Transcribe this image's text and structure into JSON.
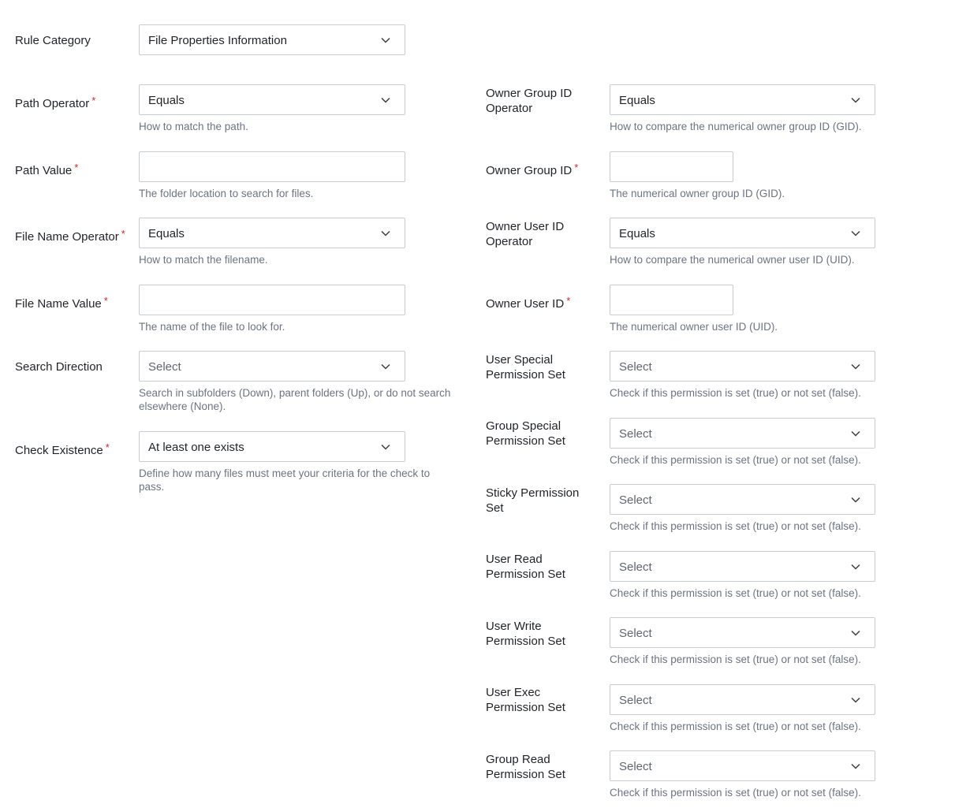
{
  "rule_category": {
    "label": "Rule Category",
    "value": "File Properties Information"
  },
  "left": {
    "path_operator": {
      "label": "Path Operator",
      "value": "Equals",
      "help": "How to match the path."
    },
    "path_value": {
      "label": "Path Value",
      "value": "",
      "help": "The folder location to search for files."
    },
    "file_name_operator": {
      "label": "File Name Operator",
      "value": "Equals",
      "help": "How to match the filename."
    },
    "file_name_value": {
      "label": "File Name Value",
      "value": "",
      "help": "The name of the file to look for."
    },
    "search_direction": {
      "label": "Search Direction",
      "value": "Select",
      "help_line1": "Search in subfolders (Down), parent folders (Up), or do not search",
      "help_line2": "elsewhere (None)."
    },
    "check_existence": {
      "label": "Check Existence",
      "value": "At least one exists",
      "help_line1": "Define how many files must meet your criteria for the check to",
      "help_line2": "pass."
    }
  },
  "right": {
    "owner_group_id_operator": {
      "label_line1": "Owner Group ID",
      "label_line2": "Operator",
      "value": "Equals",
      "help": "How to compare the numerical owner group ID (GID)."
    },
    "owner_group_id": {
      "label": "Owner Group ID",
      "value": "",
      "help": "The numerical owner group ID (GID)."
    },
    "owner_user_id_operator": {
      "label_line1": "Owner User ID",
      "label_line2": "Operator",
      "value": "Equals",
      "help": "How to compare the numerical owner user ID (UID)."
    },
    "owner_user_id": {
      "label": "Owner User ID",
      "value": "",
      "help": "The numerical owner user ID (UID)."
    },
    "user_special": {
      "label_line1": "User Special",
      "label_line2": "Permission Set",
      "value": "Select",
      "help": "Check if this permission is set (true) or not set (false)."
    },
    "group_special": {
      "label_line1": "Group Special",
      "label_line2": "Permission Set",
      "value": "Select",
      "help": "Check if this permission is set (true) or not set (false)."
    },
    "sticky": {
      "label_line1": "Sticky Permission",
      "label_line2": "Set",
      "value": "Select",
      "help": "Check if this permission is set (true) or not set (false)."
    },
    "user_read": {
      "label_line1": "User Read",
      "label_line2": "Permission Set",
      "value": "Select",
      "help": "Check if this permission is set (true) or not set (false)."
    },
    "user_write": {
      "label_line1": "User Write",
      "label_line2": "Permission Set",
      "value": "Select",
      "help": "Check if this permission is set (true) or not set (false)."
    },
    "user_exec": {
      "label_line1": "User Exec",
      "label_line2": "Permission Set",
      "value": "Select",
      "help": "Check if this permission is set (true) or not set (false)."
    },
    "group_read": {
      "label_line1": "Group Read",
      "label_line2": "Permission Set",
      "value": "Select",
      "help": "Check if this permission is set (true) or not set (false)."
    }
  },
  "required_marker": "*",
  "icons": {
    "dropdown": "chevron-down-icon"
  },
  "colors": {
    "required": "#d62424",
    "help_text": "#6b7482",
    "border": "#c7ccd3"
  }
}
